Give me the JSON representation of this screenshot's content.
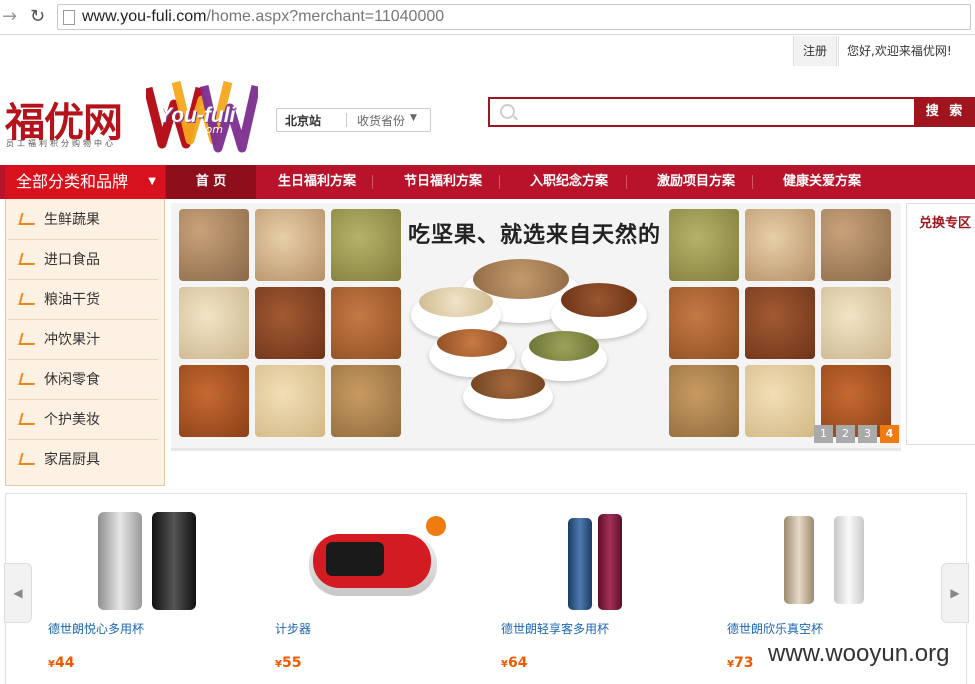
{
  "browser": {
    "url_host": "www.you-fuli.com",
    "url_rest": "/home.aspx?merchant=11040000"
  },
  "topbar": {
    "register": "注册",
    "welcome": "您好,欢迎来福优网!"
  },
  "logo": {
    "cn": "福优网",
    "sub": "员工福利积分购物中心",
    "en": "You-fuli",
    "dotcom": ".com"
  },
  "city": {
    "name": "北京站",
    "switch": "收货省份"
  },
  "search": {
    "button": "搜 索",
    "placeholder": ""
  },
  "nav": {
    "all_categories": "全部分类和品牌",
    "home": "首 页",
    "items": [
      "生日福利方案",
      "节日福利方案",
      "入职纪念方案",
      "激励项目方案",
      "健康关爱方案"
    ]
  },
  "categories": [
    "生鲜蔬果",
    "进口食品",
    "粮油干货",
    "冲饮果汁",
    "休闲零食",
    "个护美妆",
    "家居厨具"
  ],
  "banner": {
    "title": "吃坚果、就选来自天然的",
    "dots": [
      "1",
      "2",
      "3",
      "4"
    ],
    "active_dot": "4"
  },
  "exchange": {
    "title": "兑换专区"
  },
  "products": [
    {
      "name": "德世朗悦心多用杯",
      "currency": "¥",
      "price": "44"
    },
    {
      "name": "计步器",
      "currency": "¥",
      "price": "55"
    },
    {
      "name": "德世朗轻享客多用杯",
      "currency": "¥",
      "price": "64"
    },
    {
      "name": "德世朗欣乐真空杯",
      "currency": "¥",
      "price": "73"
    }
  ],
  "watermark": "www.wooyun.org",
  "colors": {
    "brand_red": "#b8132a",
    "category_red": "#d8121d",
    "price_orange": "#f05a00",
    "link_blue": "#1a66b3"
  }
}
